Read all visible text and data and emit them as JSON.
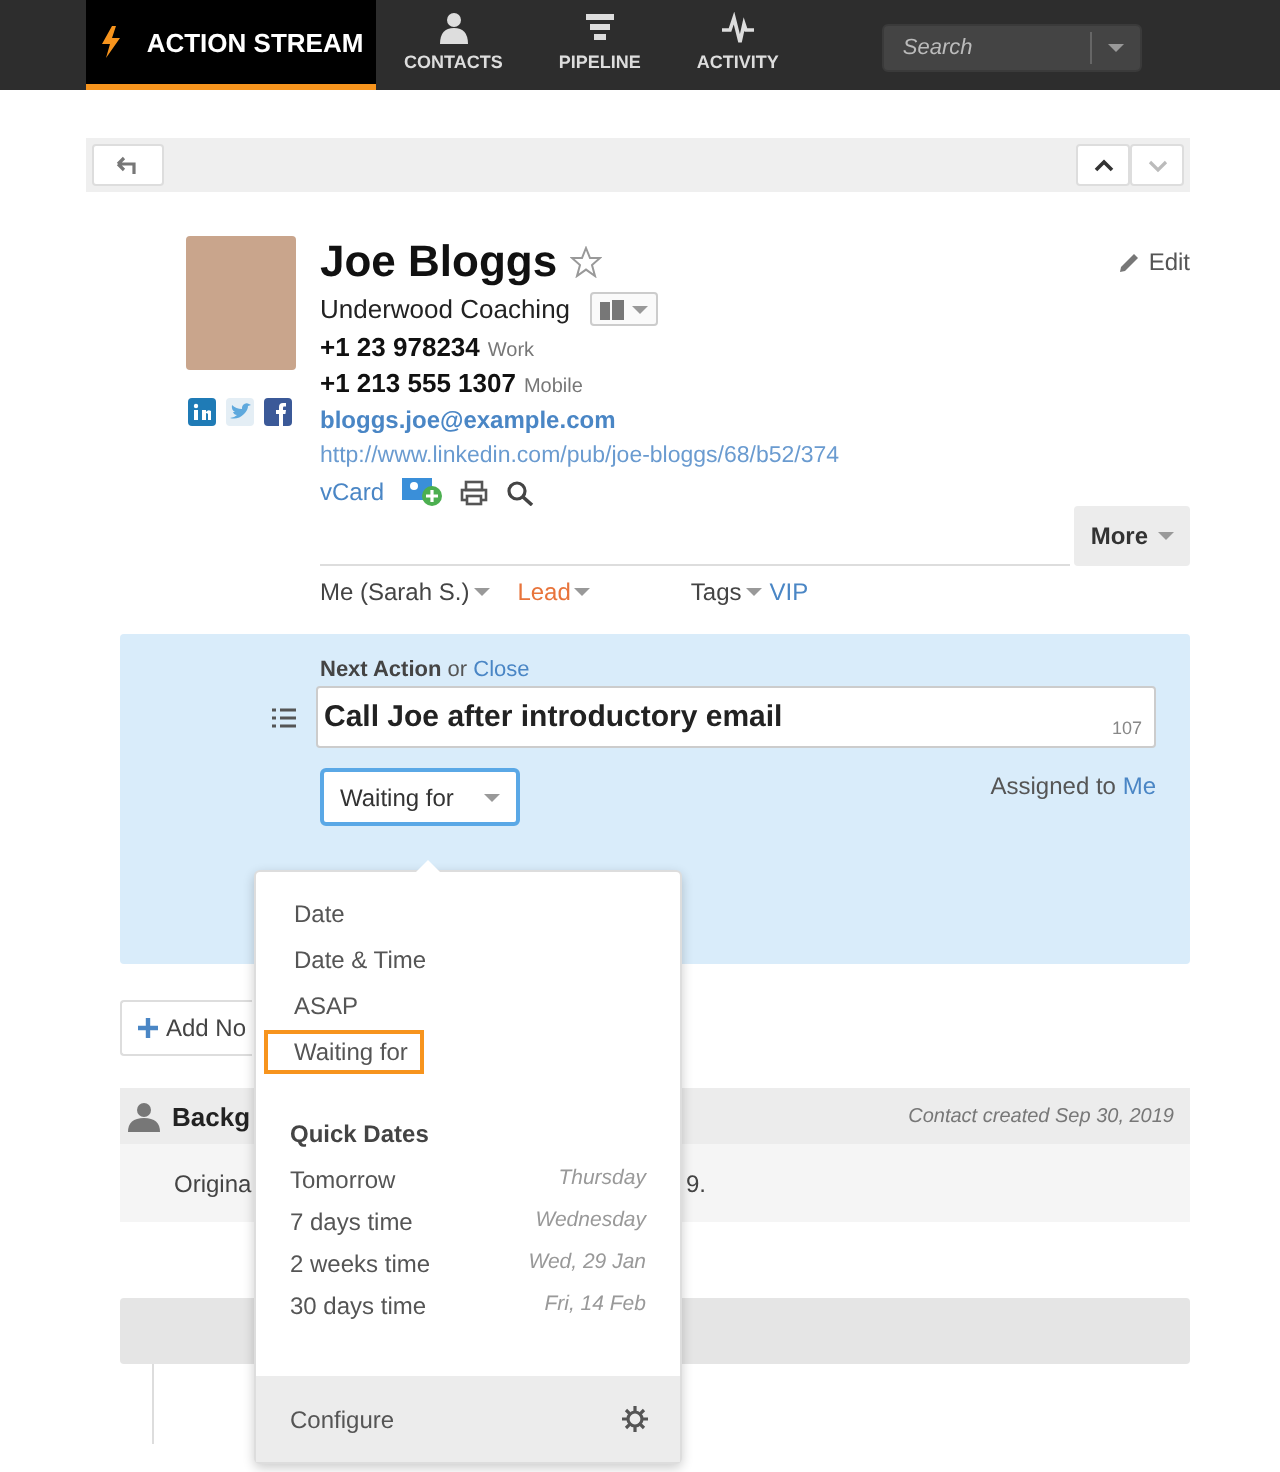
{
  "nav": {
    "tabs": [
      {
        "label": "ACTION STREAM",
        "selected": true
      },
      {
        "label": "CONTACTS",
        "selected": false
      },
      {
        "label": "PIPELINE",
        "selected": false
      },
      {
        "label": "ACTIVITY",
        "selected": false
      }
    ],
    "search": {
      "placeholder": "Search"
    }
  },
  "contact": {
    "name": "Joe Bloggs",
    "starred": false,
    "edit": "Edit",
    "company": "Underwood Coaching",
    "phones": [
      {
        "number": "+1 23 978234",
        "type": "Work"
      },
      {
        "number": "+1 213 555 1307",
        "type": "Mobile"
      }
    ],
    "email": "bloggs.joe@example.com",
    "url": "http://www.linkedin.com/pub/joe-bloggs/68/b52/374",
    "vcard": "vCard",
    "more": "More",
    "owner": "Me (Sarah S.)",
    "status": "Lead",
    "tags_label": "Tags",
    "tags": [
      "VIP"
    ]
  },
  "next_action": {
    "label": "Next Action",
    "or": "or",
    "close": "Close",
    "value": "Call Joe after introductory email",
    "count": "107",
    "date_type": "Waiting for",
    "assigned_label": "Assigned to",
    "assignee": "Me"
  },
  "dropdown": {
    "options": [
      {
        "label": "Date",
        "selected": false
      },
      {
        "label": "Date & Time",
        "selected": false
      },
      {
        "label": "ASAP",
        "selected": false
      },
      {
        "label": "Waiting for",
        "selected": true
      }
    ],
    "quick_dates_title": "Quick Dates",
    "quick_dates": [
      {
        "label": "Tomorrow",
        "hint": "Thursday"
      },
      {
        "label": "7 days time",
        "hint": "Wednesday"
      },
      {
        "label": "2 weeks time",
        "hint": "Wed, 29 Jan"
      },
      {
        "label": "30 days time",
        "hint": "Fri, 14 Feb"
      }
    ],
    "configure": "Configure"
  },
  "add_note": "Add No",
  "background": {
    "title": "Backg",
    "meta": "Contact created Sep 30, 2019",
    "text_start": "Origina",
    "text_end": "9."
  }
}
